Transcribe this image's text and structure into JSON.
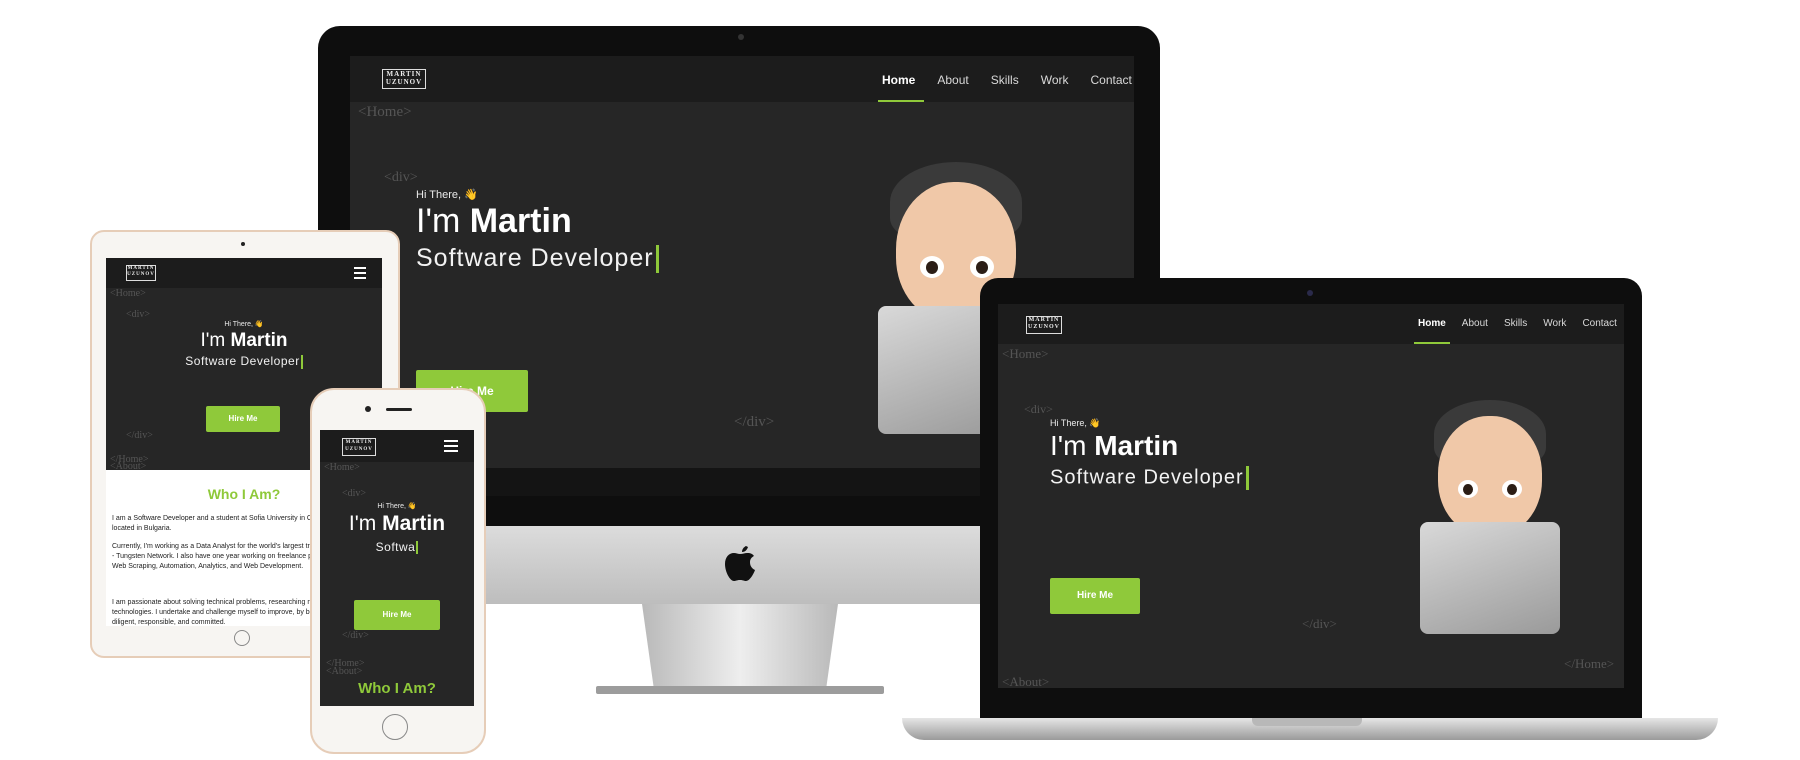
{
  "site": {
    "logo": "MARTIN UZUNOV",
    "nav": [
      "Home",
      "About",
      "Skills",
      "Work",
      "Contact"
    ],
    "code_home_open": "<Home>",
    "code_home_close": "</Home>",
    "code_div_open": "<div>",
    "code_div_close": "</div>",
    "code_about_open": "<About>",
    "greeting": "Hi There, 👋",
    "im_prefix": "I'm ",
    "name": "Martin",
    "role": "Software Developer",
    "role_typing": "Softwa",
    "hire_button": "Hire Me",
    "who_heading": "Who I Am?",
    "about_p1": "I am a Software Developer and a student at Sofia University in Computer Science, located in Bulgaria.",
    "about_p2": "Currently, I'm working as a Data Analyst for the world's largest transaction company - Tungsten Network. I also have one year working on freelance projects including Web Scraping, Automation, Analytics, and Web Development.",
    "about_p3": "I am passionate about solving technical problems, researching new software and technologies. I undertake and challenge myself to improve, by being proactive, diligent, responsible, and committed."
  },
  "colors": {
    "accent": "#8fc93a",
    "background": "#262626",
    "navbar": "#1c1c1c"
  },
  "icons": [
    "apple-logo-icon",
    "hamburger-menu-icon",
    "camera-icon",
    "home-button-icon"
  ]
}
